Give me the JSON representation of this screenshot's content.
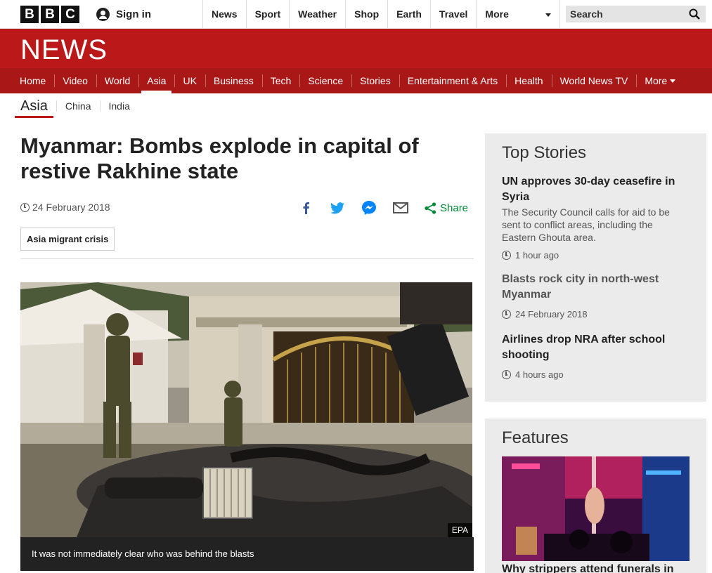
{
  "masthead": {
    "logo_letters": [
      "B",
      "B",
      "C"
    ],
    "signin_label": "Sign in",
    "nav": [
      "News",
      "Sport",
      "Weather",
      "Shop",
      "Earth",
      "Travel"
    ],
    "more_label": "More",
    "search_placeholder": "Search"
  },
  "banner": {
    "wordmark": "NEWS"
  },
  "sections": {
    "items": [
      "Home",
      "Video",
      "World",
      "Asia",
      "UK",
      "Business",
      "Tech",
      "Science",
      "Stories",
      "Entertainment & Arts",
      "Health",
      "World News TV"
    ],
    "more_label": "More",
    "active": "Asia"
  },
  "subnav": {
    "current": "Asia",
    "items": [
      "China",
      "India"
    ]
  },
  "article": {
    "headline": "Myanmar: Bombs explode in capital of restive Rakhine state",
    "date": "24 February 2018",
    "share_label": "Share",
    "tag": "Asia migrant crisis",
    "photo_credit": "EPA",
    "caption": "It was not immediately clear who was behind the blasts"
  },
  "top_stories": {
    "heading": "Top Stories",
    "stories": [
      {
        "title": "UN approves 30-day ceasefire in Syria",
        "summary": "The Security Council calls for aid to be sent to conflict areas, including the Eastern Ghouta area.",
        "time": "1 hour ago"
      },
      {
        "title": "Blasts rock city in north-west Myanmar",
        "time": "24 February 2018"
      },
      {
        "title": "Airlines drop NRA after school shooting",
        "time": "4 hours ago"
      }
    ]
  },
  "features": {
    "heading": "Features",
    "first_title": "Why strippers attend funerals in"
  },
  "colors": {
    "brand_red": "#bb1919",
    "nav_red": "#a91717",
    "share_green": "#008a38"
  }
}
